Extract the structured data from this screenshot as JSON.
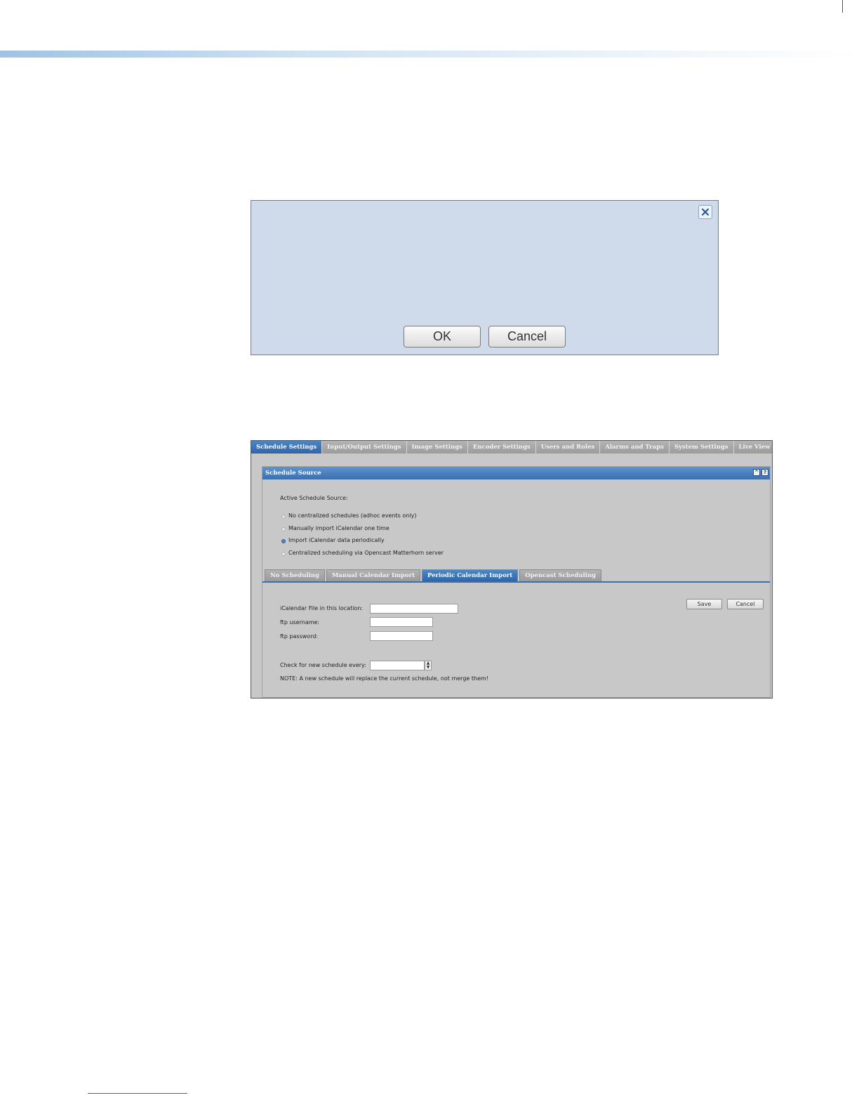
{
  "dialog": {
    "ok_label": "OK",
    "cancel_label": "Cancel",
    "close_icon": "close-icon"
  },
  "top_tabs": [
    {
      "label": "Schedule Settings",
      "active": true
    },
    {
      "label": "Input/Output Settings",
      "active": false
    },
    {
      "label": "Image Settings",
      "active": false
    },
    {
      "label": "Encoder Settings",
      "active": false
    },
    {
      "label": "Users and Roles",
      "active": false
    },
    {
      "label": "Alarms and Traps",
      "active": false
    },
    {
      "label": "System Settings",
      "active": false
    },
    {
      "label": "Live View Settings",
      "active": false
    }
  ],
  "section": {
    "title": "Schedule Source",
    "icons": [
      "collapse-icon",
      "help-icon"
    ],
    "active_source_label": "Active Schedule Source:",
    "options": [
      {
        "label": "No centralized schedules (adhoc events only)",
        "checked": false
      },
      {
        "label": "Manually import iCalendar one time",
        "checked": false
      },
      {
        "label": "Import iCalendar data periodically",
        "checked": true
      },
      {
        "label": "Centralized scheduling via Opencast Matterhorn server",
        "checked": false
      }
    ]
  },
  "sub_tabs": [
    {
      "label": "No Scheduling",
      "active": false
    },
    {
      "label": "Manual Calendar Import",
      "active": false
    },
    {
      "label": "Periodic Calendar Import",
      "active": true
    },
    {
      "label": "Opencast Scheduling",
      "active": false
    }
  ],
  "form": {
    "location_label": "iCalendar File in this location:",
    "location_value": "",
    "username_label": "ftp username:",
    "username_value": "",
    "password_label": "ftp password:",
    "password_value": "",
    "check_label": "Check for new schedule every:",
    "check_value": "",
    "note": "NOTE: A new schedule will replace the current schedule, not merge them!",
    "save_label": "Save",
    "cancel_label": "Cancel"
  },
  "colors": {
    "accent": "#3a6fb0",
    "dialog_bg": "#cfdbea",
    "panel_bg": "#c8c8c8"
  }
}
